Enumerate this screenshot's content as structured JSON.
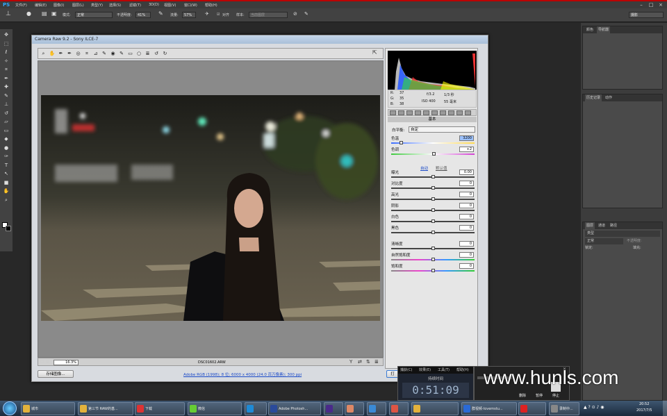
{
  "menubar": {
    "logo": "PS",
    "items": [
      "文件(F)",
      "编辑(E)",
      "图像(I)",
      "图层(L)",
      "类型(Y)",
      "选择(S)",
      "滤镜(T)",
      "3D(D)",
      "视图(V)",
      "窗口(W)",
      "帮助(H)"
    ]
  },
  "options": {
    "mode_label": "模式:",
    "mode_value": "正常",
    "opacity_label": "不透明度:",
    "opacity_value": "41%",
    "flow_label": "流量:",
    "flow_value": "57%",
    "align_label": "对齐",
    "sample_label": "样本:",
    "sample_value": "当前图层",
    "workspace": "摄影"
  },
  "camera_raw": {
    "title": "Camera Raw 9.2 - Sony ILCE-7",
    "rgb": {
      "r_label": "R:",
      "r": "37",
      "g_label": "G:",
      "g": "35",
      "b_label": "B:",
      "b": "38"
    },
    "exif": {
      "aperture": "f/3.2",
      "shutter": "1/3 秒",
      "iso": "ISO 400",
      "focal": "55 毫米"
    },
    "section": "基本",
    "wb_label": "白平衡:",
    "wb_value": "自定",
    "auto": "自动",
    "default": "默认值",
    "sliders": [
      {
        "label": "色温",
        "value": "3200",
        "pos": 0.12
      },
      {
        "label": "色调",
        "value": "+2",
        "pos": 0.51
      },
      {
        "label": "曝光",
        "value": "0.00",
        "pos": 0.5
      },
      {
        "label": "对比度",
        "value": "0",
        "pos": 0.5
      },
      {
        "label": "高光",
        "value": "0",
        "pos": 0.5
      },
      {
        "label": "阴影",
        "value": "0",
        "pos": 0.5
      },
      {
        "label": "白色",
        "value": "0",
        "pos": 0.5
      },
      {
        "label": "黑色",
        "value": "0",
        "pos": 0.5
      },
      {
        "label": "清晰度",
        "value": "0",
        "pos": 0.5
      },
      {
        "label": "自然饱和度",
        "value": "0",
        "pos": 0.5
      },
      {
        "label": "饱和度",
        "value": "0",
        "pos": 0.5
      }
    ],
    "zoom": "16.3%",
    "filename": "DSC01602.ARW",
    "save_button": "存储图像...",
    "workflow_link": "Adobe RGB (1998); 8 位; 6000 x 4000 (24.0 百万像素); 300 ppi",
    "open_button": "打"
  },
  "panels": {
    "nav": [
      "颜色",
      "导航器"
    ],
    "history": [
      "历史记录",
      "动作"
    ],
    "layers": [
      "图层",
      "通道",
      "路径"
    ],
    "layer_kind": "类型",
    "blend": "正常",
    "opacity_label": "不透明度:",
    "lock_label": "锁定:",
    "fill_label": "填充:"
  },
  "timer": {
    "menu": [
      "捕获(C)",
      "效果(E)",
      "工具(T)",
      "帮助(H)"
    ],
    "title": "持续时间",
    "time": "0:51:09",
    "btns": [
      "删除",
      "暂停",
      "停止"
    ]
  },
  "watermark": "www.hunls.com",
  "taskbar": {
    "items": [
      "城市",
      "第三节 RAW的基...",
      "下载",
      "微信",
      "",
      "Adobe Photosh...",
      "",
      "",
      "",
      "",
      "",
      "群视频-lovemstu...",
      "",
      "录制中..."
    ],
    "time": "20:52",
    "date": "2017/7/5"
  }
}
